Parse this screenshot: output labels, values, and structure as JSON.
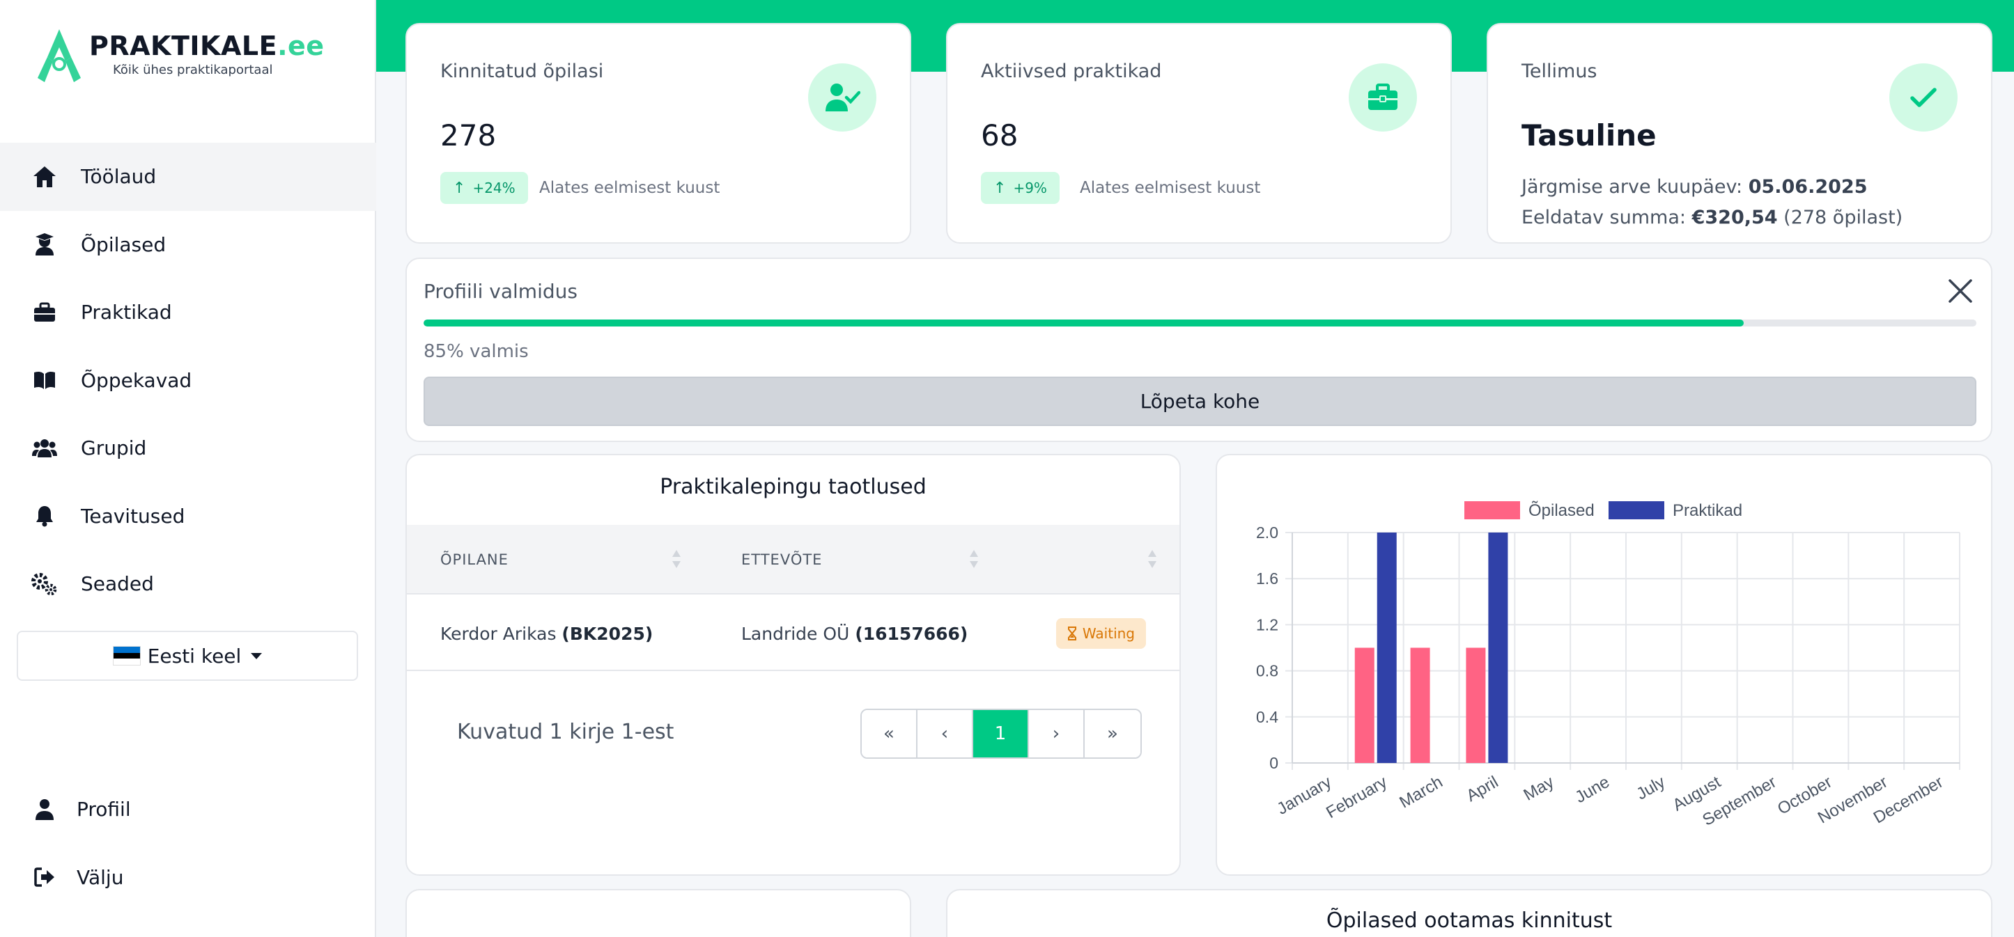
{
  "brand": {
    "name": "PRAKTIKALE",
    "tld": ".ee",
    "tagline": "Kõik ühes praktikaportaal"
  },
  "sidebar": {
    "items": [
      {
        "label": "Töölaud",
        "icon": "home-icon",
        "active": true
      },
      {
        "label": "Õpilased",
        "icon": "student-icon"
      },
      {
        "label": "Praktikad",
        "icon": "briefcase-icon"
      },
      {
        "label": "Õppekavad",
        "icon": "book-icon"
      },
      {
        "label": "Grupid",
        "icon": "users-icon"
      },
      {
        "label": "Teavitused",
        "icon": "bell-icon"
      },
      {
        "label": "Seaded",
        "icon": "gears-icon"
      }
    ],
    "language": "Eesti keel",
    "bottom": [
      {
        "label": "Profiil",
        "icon": "user-icon"
      },
      {
        "label": "Välju",
        "icon": "logout-icon"
      }
    ]
  },
  "stats": [
    {
      "label": "Kinnitatud õpilasi",
      "value": "278",
      "badge": "+24%",
      "note": "Alates eelmisest kuust",
      "icon": "user-check-icon"
    },
    {
      "label": "Aktiivsed praktikad",
      "value": "68",
      "badge": "+9%",
      "note": "Alates eelmisest kuust",
      "icon": "briefcase-icon"
    }
  ],
  "subscription": {
    "label": "Tellimus",
    "value": "Tasuline",
    "next_invoice_label": "Järgmise arve kuupäev:",
    "next_invoice_date": "05.06.2025",
    "amount_label": "Eeldatav summa:",
    "amount": "€320,54",
    "amount_note": "(278 õpilast)",
    "icon": "check-icon"
  },
  "profile": {
    "title": "Profiili valmidus",
    "progress": 85,
    "progress_text": "85% valmis",
    "button": "Lõpeta kohe"
  },
  "applications": {
    "title": "Praktikalepingu taotlused",
    "columns": [
      "ÕPILANE",
      "ETTEVÕTE",
      ""
    ],
    "rows": [
      {
        "student": "Kerdor Arikas",
        "student_code": "(BK2025)",
        "company": "Landride OÜ",
        "company_code": "(16157666)",
        "status": "Waiting"
      }
    ],
    "info": "Kuvatud 1 kirje 1-est",
    "pager": [
      "«",
      "‹",
      "1",
      "›",
      "»"
    ],
    "current_page": "1"
  },
  "bottom_cards": {
    "right_title": "Õpilased ootamas kinnitust"
  },
  "colors": {
    "accent": "#00c985",
    "series_students": "#ff6384",
    "series_internships": "#3041a8"
  },
  "chart_data": {
    "type": "bar",
    "categories": [
      "January",
      "February",
      "March",
      "April",
      "May",
      "June",
      "July",
      "August",
      "September",
      "October",
      "November",
      "December"
    ],
    "series": [
      {
        "name": "Õpilased",
        "color": "#ff6384",
        "values": [
          0,
          1,
          1,
          1,
          0,
          0,
          0,
          0,
          0,
          0,
          0,
          0
        ]
      },
      {
        "name": "Praktikad",
        "color": "#3041a8",
        "values": [
          0,
          2,
          0,
          2,
          0,
          0,
          0,
          0,
          0,
          0,
          0,
          0
        ]
      }
    ],
    "yticks": [
      "0",
      "0.4",
      "0.8",
      "1.2",
      "1.6",
      "2.0"
    ],
    "ylim": [
      0,
      2
    ],
    "legend": "top-center",
    "grid": true
  }
}
